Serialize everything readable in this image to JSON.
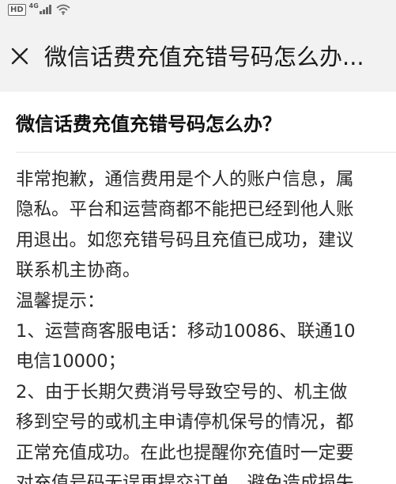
{
  "status_bar": {
    "hd_badge": "HD",
    "network_label": "4G",
    "icons": [
      "signal-icon",
      "wifi-icon"
    ]
  },
  "nav": {
    "close_icon": "close-icon",
    "title": "微信话费充值充错号码怎么办..."
  },
  "article": {
    "title": "微信话费充值充错号码怎么办？",
    "lines": [
      "非常抱歉，通信费用是个人的账户信息，属",
      "隐私。平台和运营商都不能把已经到他人账",
      "用退出。如您充错号码且充值已成功，建议",
      "联系机主协商。",
      "温馨提示：",
      "1、运营商客服电话：移动10086、联通10",
      "电信10000；",
      "2、由于长期欠费消号导致空号的、机主做",
      "移到空号的或机主申请停机保号的情况，都",
      "正常充值成功。在此也提醒你充值时一定要",
      "对充值号码无误再提交订单，避免造成损失"
    ]
  },
  "colors": {
    "header_background": "#f2f2f2",
    "content_background": "#ffffff",
    "title_text": "#111111",
    "body_text": "#2a2a2a"
  }
}
